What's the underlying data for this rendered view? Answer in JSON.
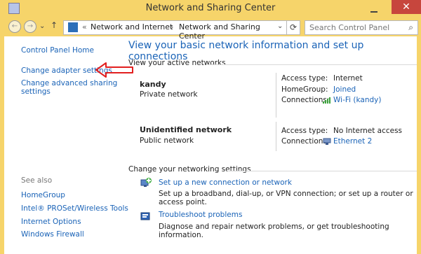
{
  "window": {
    "title": "Network and Sharing Center",
    "close_glyph": "✕"
  },
  "address": {
    "prefix": "«",
    "crumbs": [
      "Network and Internet",
      "Network and Sharing Center"
    ],
    "sep": "›",
    "search_placeholder": "Search Control Panel"
  },
  "sidebar": {
    "home": "Control Panel Home",
    "links": [
      "Change adapter settings",
      "Change advanced sharing settings"
    ],
    "see_also_title": "See also",
    "see_also": [
      "HomeGroup",
      "Intel® PROSet/Wireless Tools",
      "Internet Options",
      "Windows Firewall"
    ]
  },
  "main": {
    "heading": "View your basic network information and set up connections",
    "active_title": "View your active networks",
    "networks": [
      {
        "name": "kandy",
        "type": "Private network",
        "rows": [
          {
            "label": "Access type:",
            "value": "Internet",
            "is_link": false
          },
          {
            "label": "HomeGroup:",
            "value": "Joined",
            "is_link": true
          },
          {
            "label": "Connections:",
            "value": "Wi-Fi (kandy)",
            "is_link": true,
            "icon": "wifi-signal-icon"
          }
        ]
      },
      {
        "name": "Unidentified network",
        "type": "Public network",
        "rows": [
          {
            "label": "Access type:",
            "value": "No Internet access",
            "is_link": false
          },
          {
            "label": "Connections:",
            "value": "Ethernet 2",
            "is_link": true,
            "icon": "ethernet-icon"
          }
        ]
      }
    ],
    "settings_title": "Change your networking settings",
    "tasks": [
      {
        "title": "Set up a new connection or network",
        "desc": "Set up a broadband, dial-up, or VPN connection; or set up a router or access point.",
        "icon": "new-connection-icon"
      },
      {
        "title": "Troubleshoot problems",
        "desc": "Diagnose and repair network problems, or get troubleshooting information.",
        "icon": "troubleshoot-icon"
      }
    ]
  },
  "colors": {
    "frame": "#f6d46a",
    "link": "#1a63b7",
    "close": "#c7463d",
    "annotation_arrow": "#e21f1f"
  }
}
